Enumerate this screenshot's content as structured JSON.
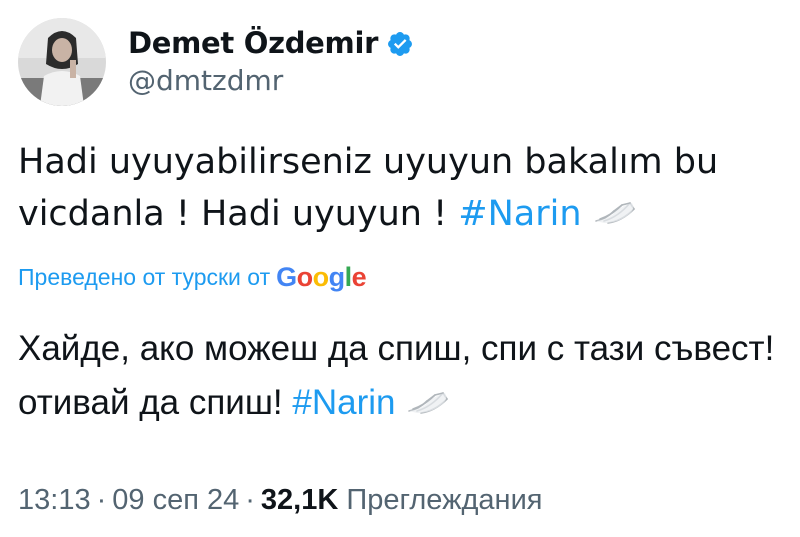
{
  "author": {
    "display_name": "Demet Özdemir",
    "handle": "@dmtzdmr",
    "verified_icon": "verified-badge-icon",
    "verified_color": "#1d9bf0"
  },
  "tweet": {
    "text_plain": "Hadi uyuyabilirseniz uyuyun bakalım bu vicdanla ! Hadi uyuyun !",
    "hashtag": "#Narin",
    "hashtag_emoji": "wings-icon"
  },
  "translation": {
    "label": "Преведено от турски от",
    "provider": {
      "letters": [
        "G",
        "o",
        "o",
        "g",
        "l",
        "e"
      ]
    },
    "text_plain": "Хайде, ако можеш да спиш, спи с тази съвест! отивай да спиш!",
    "hashtag": "#Narin"
  },
  "meta": {
    "time": "13:13",
    "separator": "·",
    "date": "09 сеп 24",
    "views_count": "32,1K",
    "views_label": "Преглеждания"
  },
  "colors": {
    "link": "#1d9bf0",
    "text": "#0f1419",
    "secondary": "#536471",
    "google_blue": "#4285f4",
    "google_red": "#ea4335",
    "google_yellow": "#fbbc05",
    "google_green": "#34a853"
  }
}
